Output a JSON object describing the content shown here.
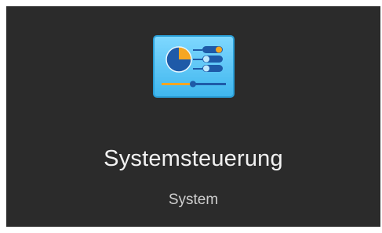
{
  "result_card": {
    "icon": "control-panel-icon",
    "title": "Systemsteuerung",
    "subtitle": "System"
  },
  "colors": {
    "tile_background": "#2b2b2b",
    "title_text": "#f2f2f2",
    "subtitle_text": "#cfcfcf",
    "icon_blue": "#4fc3f7",
    "icon_orange": "#f5a623",
    "icon_dark_blue": "#1565c0"
  }
}
